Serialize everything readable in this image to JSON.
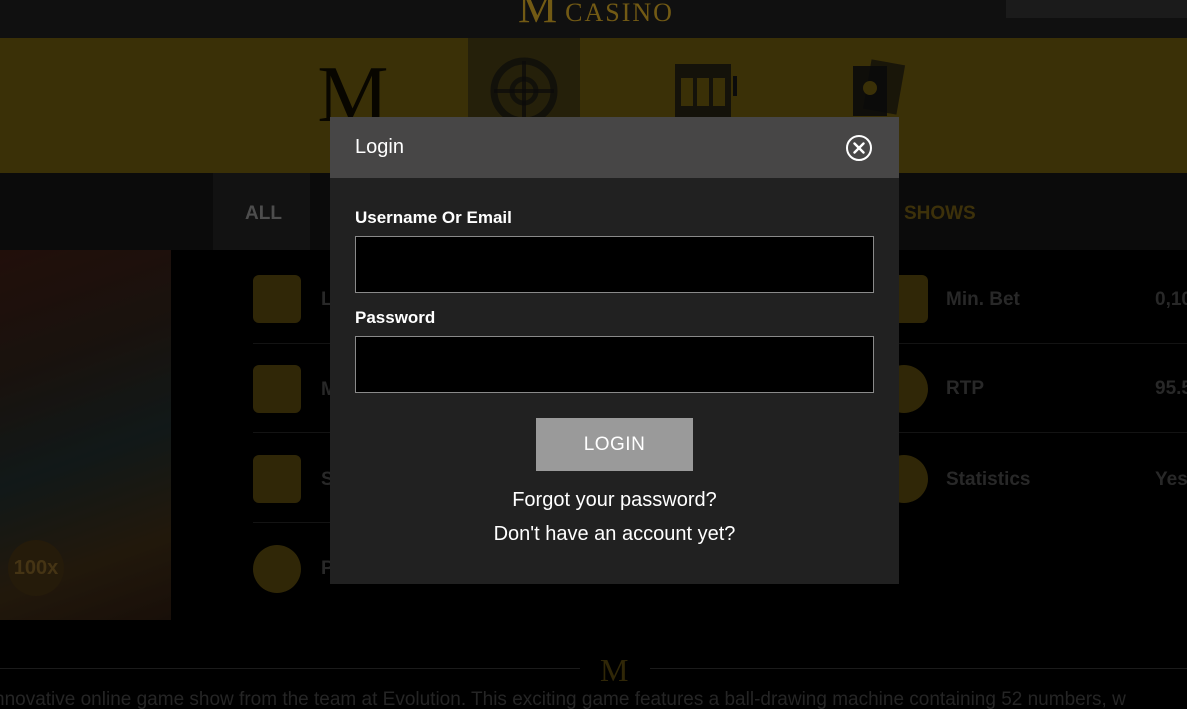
{
  "site": {
    "logo_letter": "M",
    "logo_word": "CASINO"
  },
  "categories": {
    "m_glyph": "M",
    "icons": [
      "m-logo-icon",
      "roulette-icon",
      "slot-machine-icon",
      "playing-cards-icon"
    ]
  },
  "tabs": {
    "all": "ALL",
    "game_shows": "E SHOWS"
  },
  "game_info": {
    "left": [
      {
        "icon": "video-icon",
        "label": "L"
      },
      {
        "icon": "wallet-up-icon",
        "label": "M"
      },
      {
        "icon": "wallet-plus-icon",
        "label": "S"
      },
      {
        "icon": "palette-icon",
        "label": "P"
      }
    ],
    "right": [
      {
        "icon": "wallet-down-icon",
        "label": "Min. Bet",
        "value": "0,10"
      },
      {
        "icon": "percent-icon",
        "label": "RTP",
        "value": "95.5"
      },
      {
        "icon": "statistics-icon",
        "label": "Statistics",
        "value": "Yes"
      }
    ]
  },
  "thumbnail_badge": "100x",
  "footer": {
    "m_glyph": "M",
    "description": "nnovative online game show from the team at Evolution. This exciting game features a ball-drawing machine containing 52 numbers, w"
  },
  "login_modal": {
    "title": "Login",
    "close_icon": "close-circle-icon",
    "username_label": "Username Or Email",
    "username_value": "",
    "password_label": "Password",
    "password_value": "",
    "submit_label": "LOGIN",
    "forgot_link": "Forgot your password?",
    "signup_link": "Don't have an account yet?"
  },
  "colors": {
    "accent_gold": "#b08a20",
    "modal_bg": "#212121",
    "modal_header": "#474646",
    "button_gray": "#9a9a9a"
  }
}
